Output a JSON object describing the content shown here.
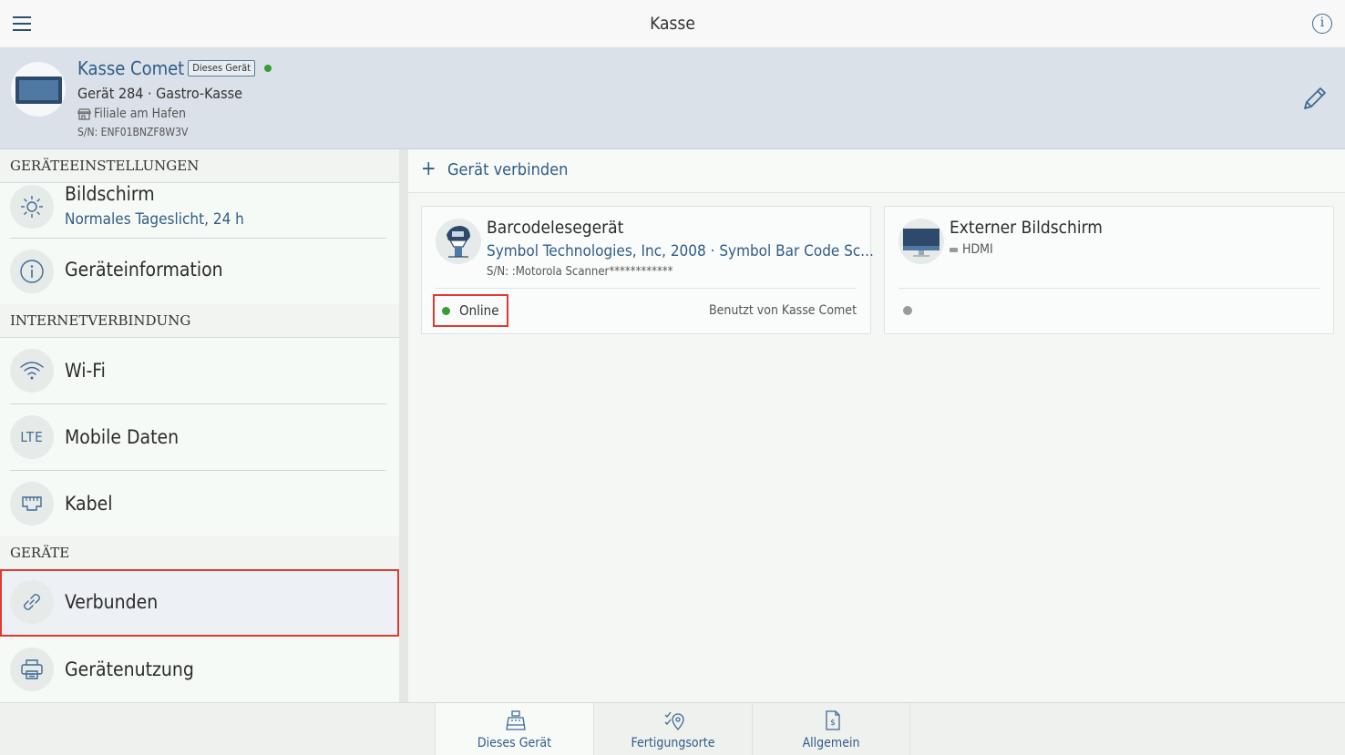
{
  "topbar": {
    "title": "Kasse",
    "menu_icon": "hamburger-icon",
    "info_icon": "info-icon"
  },
  "device": {
    "name": "Kasse Comet",
    "badge": "Dieses Gerät",
    "status_color": "#3a9c32",
    "subtitle": "Gerät 284 · Gastro-Kasse",
    "location": "Filiale am Hafen",
    "serial": "S/N: ENF01BNZF8W3V"
  },
  "sidebar": {
    "sections": [
      {
        "title": "GERÄTEEINSTELLUNGEN"
      },
      {
        "title": "INTERNETVERBINDUNG"
      },
      {
        "title": "GERÄTE"
      }
    ],
    "items": [
      {
        "label": "Bildschirm",
        "sublabel": "Normales Tageslicht, 24 h",
        "icon": "brightness-icon"
      },
      {
        "label": "Geräteinformation",
        "icon": "info-icon"
      },
      {
        "label": "Wi-Fi",
        "icon": "wifi-icon"
      },
      {
        "label": "Mobile Daten",
        "icon_text": "LTE"
      },
      {
        "label": "Kabel",
        "icon": "ethernet-icon"
      },
      {
        "label": "Verbunden",
        "icon": "link-icon"
      },
      {
        "label": "Gerätenutzung",
        "icon": "printer-icon"
      }
    ]
  },
  "main": {
    "connect_label": "Gerät verbinden",
    "cards": [
      {
        "title": "Barcodelesegerät",
        "make": "Symbol Technologies, Inc, 2008 · Symbol Bar Code Sc...",
        "serial": "S/N: :Motorola Scanner************",
        "status": "Online",
        "used_by": "Benutzt von Kasse Comet",
        "icon": "barcode-scanner-icon"
      },
      {
        "title": "Externer Bildschirm",
        "connection": "HDMI",
        "icon": "monitor-icon"
      }
    ]
  },
  "bottom_nav": [
    {
      "label": "Dieses Gerät",
      "icon": "cash-register-icon",
      "active": true
    },
    {
      "label": "Fertigungsorte",
      "icon": "location-check-icon"
    },
    {
      "label": "Allgemein",
      "icon": "document-dollar-icon"
    }
  ]
}
